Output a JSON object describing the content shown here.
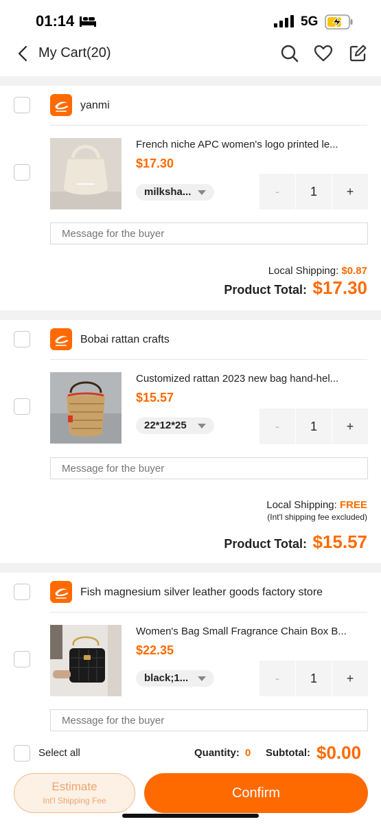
{
  "status_bar": {
    "time": "01:14",
    "network": "5G"
  },
  "nav": {
    "title": "My Cart(20)"
  },
  "stores": [
    {
      "name": "yanmi",
      "product": {
        "title": "French niche APC women's logo printed le...",
        "price": "$17.30",
        "variant": "milksha...",
        "quantity": "1",
        "message_placeholder": "Message for the buyer"
      },
      "shipping_label": "Local Shipping:",
      "shipping_value": "$0.87",
      "total_label": "Product Total:",
      "total_value": "$17.30"
    },
    {
      "name": "Bobai rattan crafts",
      "product": {
        "title": "Customized rattan 2023 new bag hand-hel...",
        "price": "$15.57",
        "variant": "22*12*25",
        "quantity": "1",
        "message_placeholder": "Message for the buyer"
      },
      "shipping_label": "Local Shipping:",
      "shipping_value": "FREE",
      "shipping_note": "(Int'l shipping fee excluded)",
      "total_label": "Product Total:",
      "total_value": "$15.57"
    },
    {
      "name": "Fish magnesium silver leather goods factory store",
      "product": {
        "title": "Women's Bag Small Fragrance Chain Box B...",
        "price": "$22.35",
        "variant": "black;1...",
        "quantity": "1",
        "message_placeholder": "Message for the buyer"
      }
    }
  ],
  "stepper": {
    "minus": "-",
    "plus": "+"
  },
  "bottom": {
    "select_all": "Select all",
    "quantity_label": "Quantity:",
    "quantity_value": "0",
    "subtotal_label": "Subtotal:",
    "subtotal_value": "$0.00",
    "estimate_label": "Estimate",
    "estimate_sub": "Int'l Shipping Fee",
    "confirm_label": "Confirm"
  },
  "colors": {
    "accent": "#ff6a00",
    "estimate_bg": "#fdf0e4",
    "divider": "#f2f2f2"
  }
}
